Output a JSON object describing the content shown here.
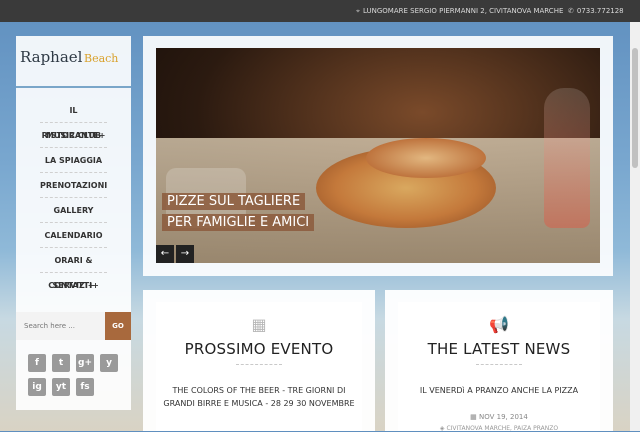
{
  "topbar": {
    "address": "LUNGOMARE SERGIO PIERMANNI 2, CIVITANOVA MARCHE",
    "phone": "0733.772128"
  },
  "logo": {
    "part1": "Raphael",
    "part2": "Beach"
  },
  "menu": {
    "items": [
      "IL RISTORANTE+",
      "MUSIC CLUB",
      "LA SPIAGGIA",
      "PRENOTAZIONI",
      "GALLERY",
      "CALENDARIO",
      "ORARI & SERVIZI+",
      "CONTATTI+"
    ]
  },
  "search": {
    "placeholder": "Search here ...",
    "button": "GO"
  },
  "social": [
    "f",
    "t",
    "g+",
    "y",
    "ig",
    "yt",
    "fs"
  ],
  "hero": {
    "caption_line1": "PIZZE SUL TAGLIERE",
    "caption_line2": "PER FAMIGLIE E AMICI",
    "prev": "←",
    "next": "→"
  },
  "event": {
    "title": "PROSSIMO EVENTO",
    "body": "THE COLORS OF THE BEER - TRE GIORNI DI GRANDI BIRRE E MUSICA - 28 29 30 NOVEMBRE"
  },
  "news": {
    "title": "THE LATEST NEWS",
    "body": "IL VENERDì A PRANZO ANCHE LA PIZZA",
    "date": "NOV 19, 2014",
    "tags": "CIVITANOVA MARCHE, PAIZA PRANZO"
  },
  "colors": {
    "accent": "#a8693d",
    "topbar": "#3a3a3a",
    "logo_line": "#7aa6c9"
  }
}
